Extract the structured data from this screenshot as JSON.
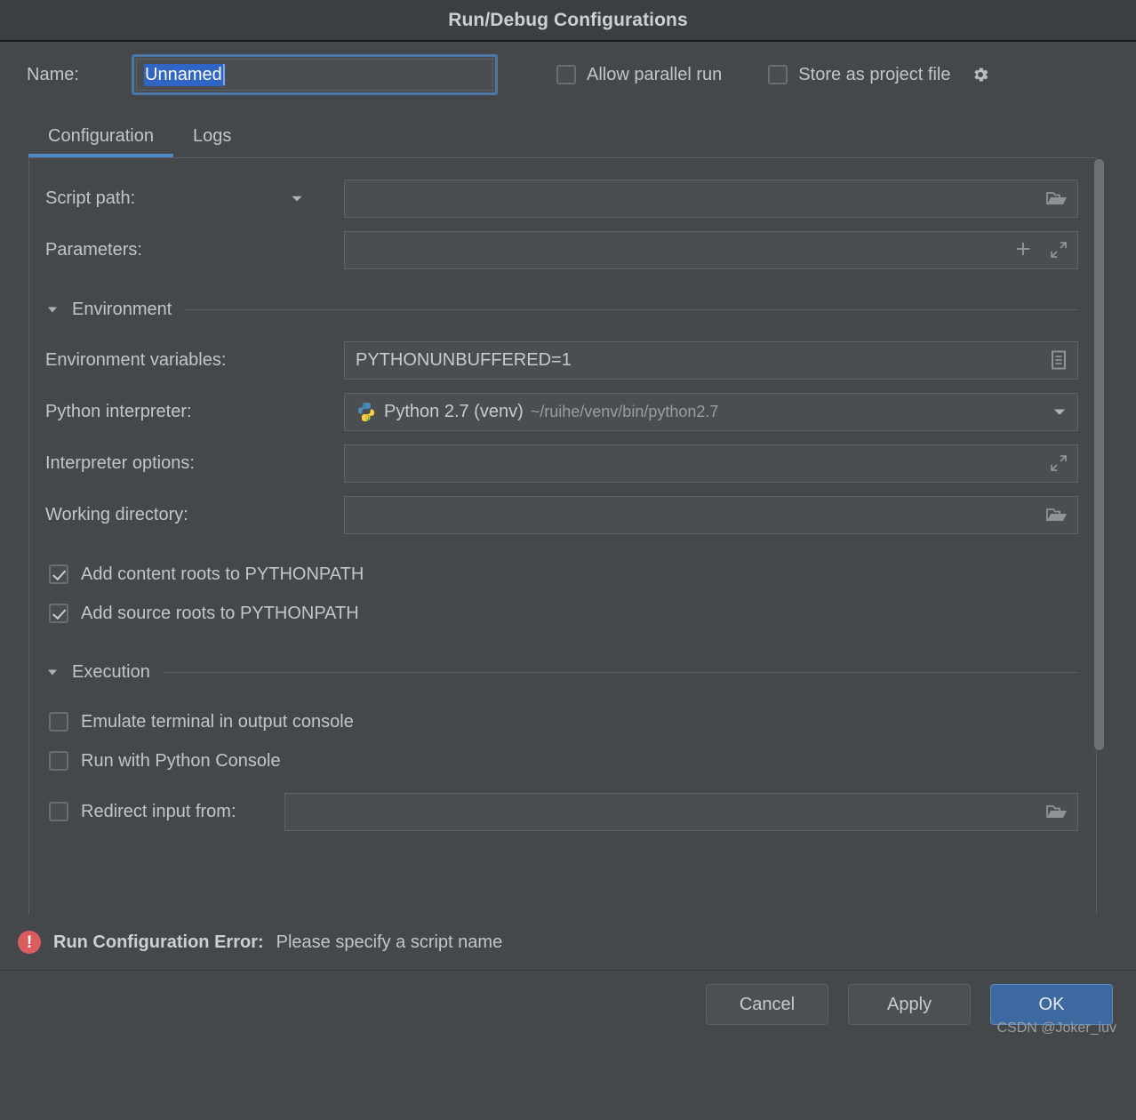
{
  "dialog": {
    "title": "Run/Debug Configurations"
  },
  "name_row": {
    "label": "Name:",
    "value": "Unnamed",
    "allow_parallel_run": {
      "label": "Allow parallel run",
      "checked": false
    },
    "store_as_project_file": {
      "label": "Store as project file",
      "checked": false
    },
    "gear_icon": "gear-icon"
  },
  "tabs": [
    {
      "label": "Configuration",
      "active": true
    },
    {
      "label": "Logs",
      "active": false
    }
  ],
  "form": {
    "script_path": {
      "label": "Script path:",
      "value": "",
      "dropdown_icon": "chevron-down-icon",
      "browse_icon": "folder-icon"
    },
    "parameters": {
      "label": "Parameters:",
      "value": "",
      "add_icon": "plus-icon",
      "expand_icon": "expand-icon"
    },
    "environment_section": {
      "label": "Environment",
      "collapse_icon": "triangle-down-icon"
    },
    "environment_variables": {
      "label": "Environment variables:",
      "value": "PYTHONUNBUFFERED=1",
      "edit_icon": "list-document-icon"
    },
    "python_interpreter": {
      "label": "Python interpreter:",
      "value": "Python 2.7 (venv)",
      "path": "~/ruihe/venv/bin/python2.7",
      "icon": "python-icon",
      "dropdown_icon": "chevron-down-icon"
    },
    "interpreter_options": {
      "label": "Interpreter options:",
      "value": "",
      "expand_icon": "expand-icon"
    },
    "working_directory": {
      "label": "Working directory:",
      "value": "",
      "browse_icon": "folder-icon"
    },
    "add_content_roots": {
      "label": "Add content roots to PYTHONPATH",
      "checked": true
    },
    "add_source_roots": {
      "label": "Add source roots to PYTHONPATH",
      "checked": true
    },
    "execution_section": {
      "label": "Execution",
      "collapse_icon": "triangle-down-icon"
    },
    "emulate_terminal": {
      "label": "Emulate terminal in output console",
      "checked": false
    },
    "run_with_python_console": {
      "label": "Run with Python Console",
      "checked": false
    },
    "redirect_input": {
      "label": "Redirect input from:",
      "checked": false,
      "value": "",
      "browse_icon": "folder-icon"
    }
  },
  "error": {
    "icon": "error-icon",
    "title": "Run Configuration Error:",
    "message": "Please specify a script name"
  },
  "buttons": {
    "cancel": "Cancel",
    "apply": "Apply",
    "ok": "OK"
  },
  "watermark": "CSDN @Joker_iuv",
  "colors": {
    "accent": "#4a88c7",
    "primary_button": "#3c6aa0",
    "selection": "#2f65c4",
    "error": "#db5c5c",
    "background": "#45484a",
    "titlebar": "#3c3f41"
  }
}
